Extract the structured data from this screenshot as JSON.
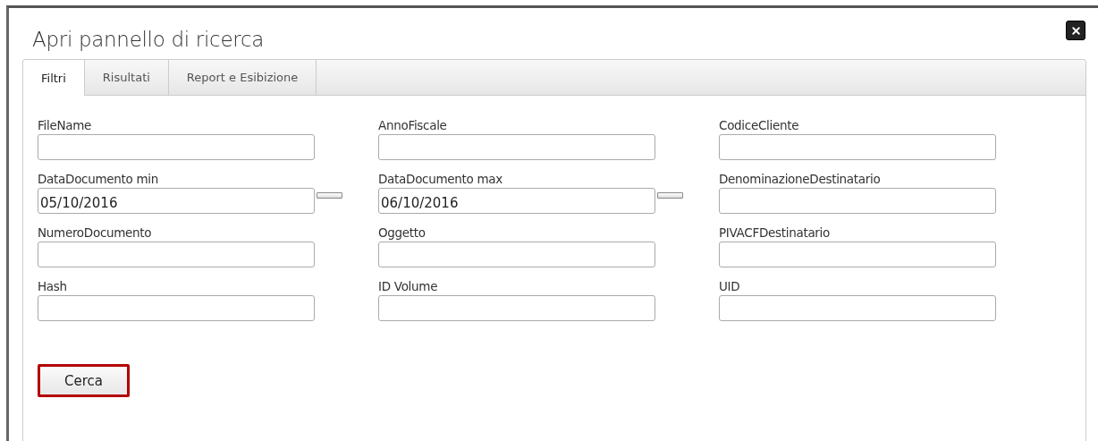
{
  "window": {
    "title": "Apri pannello di ricerca"
  },
  "tabs": [
    {
      "label": "Filtri",
      "selected": true
    },
    {
      "label": "Risultati",
      "selected": false
    },
    {
      "label": "Report e Esibizione",
      "selected": false
    }
  ],
  "fields": [
    {
      "label": "FileName",
      "kind": "text"
    },
    {
      "label": "AnnoFiscale",
      "kind": "text"
    },
    {
      "label": "CodiceCliente",
      "kind": "text"
    },
    {
      "label": "DataDocumento min",
      "kind": "date",
      "value": "05/10/2016"
    },
    {
      "label": "DataDocumento max",
      "kind": "date",
      "value": "06/10/2016"
    },
    {
      "label": "DenominazioneDestinatario",
      "kind": "text"
    },
    {
      "label": "NumeroDocumento",
      "kind": "text"
    },
    {
      "label": "Oggetto",
      "kind": "text"
    },
    {
      "label": "PIVACFDestinatario",
      "kind": "text"
    },
    {
      "label": "Hash",
      "kind": "text"
    },
    {
      "label": "ID Volume",
      "kind": "text"
    },
    {
      "label": "UID",
      "kind": "text"
    }
  ],
  "search_button": {
    "label": "Cerca",
    "highlighted": true
  }
}
